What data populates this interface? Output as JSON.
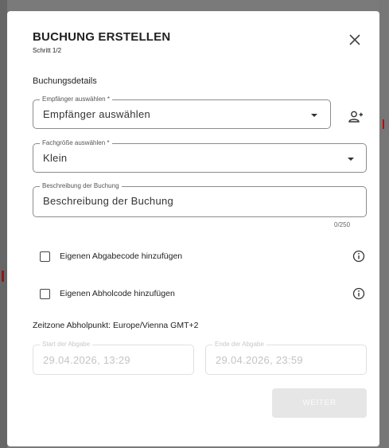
{
  "dialog": {
    "title": "BUCHUNG ERSTELLEN",
    "step": "Schritt 1/2",
    "section_label": "Buchungsdetails",
    "recipient": {
      "label": "Empfänger auswählen *",
      "value": "Empfänger auswählen"
    },
    "size": {
      "label": "Fachgröße auswählen *",
      "value": "Klein"
    },
    "description": {
      "label": "Beschreibung der Buchung",
      "value": "Beschreibung der Buchung",
      "counter": "0/250"
    },
    "dropoff_code": {
      "label": "Eigenen Abgabecode hinzufügen",
      "checked": false
    },
    "pickup_code": {
      "label": "Eigenen Abholcode hinzufügen",
      "checked": false
    },
    "timezone": "Zeitzone Abholpunkt: Europe/Vienna GMT+2",
    "start": {
      "label": "Start der Abgabe",
      "value": "29.04.2026, 13:29"
    },
    "end": {
      "label": "Ende der Abgabe",
      "value": "29.04.2026, 23:59"
    },
    "next_button": "WEITER"
  },
  "icons": {
    "close": "close-icon",
    "add_person": "person-add-icon",
    "info": "info-icon",
    "dropdown": "caret-down-icon"
  },
  "colors": {
    "overlay": "#7a7a7a",
    "disabled_button_bg": "#e6e6e6",
    "border": "#8c8c8c"
  }
}
